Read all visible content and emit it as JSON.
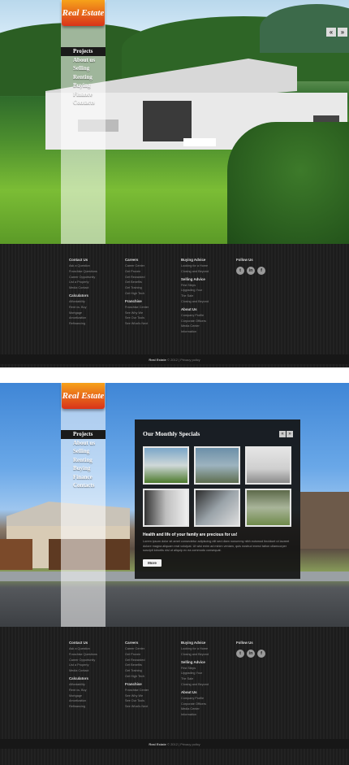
{
  "brand": {
    "logo_text": "Real Estate"
  },
  "nav": {
    "items": [
      "Projects",
      "About us",
      "Selling",
      "Renting",
      "Buying",
      "Finance",
      "Contacts"
    ],
    "active_index": 0
  },
  "slider": {
    "prev": "«",
    "next": "»"
  },
  "footer": {
    "col1": {
      "heading": "Contact Us",
      "links": [
        "Ask a Question",
        "Franchise Questions",
        "Career Opportunity",
        "List a Property",
        "Media Contact"
      ],
      "heading2": "Calculators",
      "links2": [
        "Affordability",
        "Rent vs. Buy",
        "Mortgage",
        "Amortization",
        "Refinancing"
      ]
    },
    "col2": {
      "heading": "Careers",
      "links": [
        "Career Center",
        "Get Proven",
        "Get Rewarded",
        "Get Benefits",
        "Get Training",
        "Get High Tech"
      ],
      "heading2": "Franchise",
      "links2": [
        "Franchise Center",
        "See Why We",
        "See Our Tools",
        "See What's Next"
      ]
    },
    "col3": {
      "heading": "Buying Advice",
      "links": [
        "Looking for a Home",
        "Closing and Beyond"
      ],
      "heading2": "Selling Advice",
      "links2": [
        "First Steps",
        "Upgrading Your",
        "The Sale",
        "Closing and Beyond"
      ],
      "heading3": "About Us",
      "links3": [
        "Company Profile",
        "Corporate Officers",
        "Media Center",
        "Information"
      ]
    },
    "col4": {
      "heading": "Follow Us",
      "social": [
        "t",
        "in",
        "f"
      ]
    },
    "copyright": {
      "brand": "Real Estate",
      "text": "© 2012 | Privacy policy"
    }
  },
  "specials": {
    "title": "Our Monthly Specials",
    "prev": "«",
    "next": "»",
    "subtitle": "Health and life of your family are precious for us!",
    "paragraph": "Lorem ipsum dolor sit amet consectetur adipiscing elit sed diam nonummy nibh euismod tincidunt ut laoreet dolore magna aliquam erat volutpat. Ut wisi enim ad minim veniam, quis nostrud exerci tation ullamcorper suscipit lobortis nisl ut aliquip ex ea commodo consequat.",
    "more_label": "More"
  }
}
